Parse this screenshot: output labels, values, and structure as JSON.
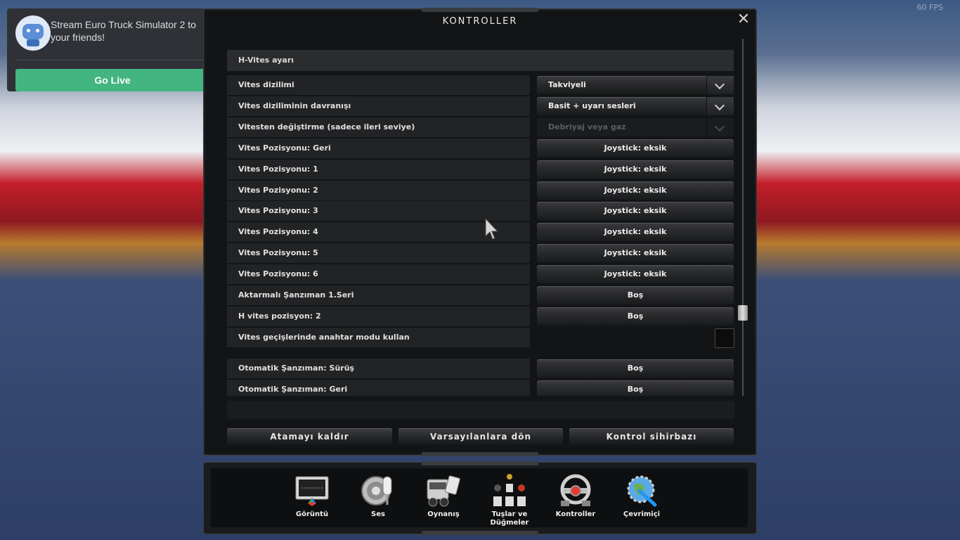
{
  "fps": "60 FPS",
  "discord": {
    "message": "Stream Euro Truck Simulator 2 to your friends!",
    "go_live": "Go Live"
  },
  "dialog": {
    "title": "KONTROLLER",
    "close": "✕",
    "section": "H-Vites ayarı",
    "rows": [
      {
        "label": "Vites dizilimi",
        "value": "Takviyeli",
        "type": "dropdown"
      },
      {
        "label": "Vites diziliminin davranışı",
        "value": "Basit + uyarı sesleri",
        "type": "dropdown"
      },
      {
        "label": "Vitesten değiştirme (sadece ileri seviye)",
        "value": "Debriyaj veya gaz",
        "type": "dropdown-disabled"
      },
      {
        "label": "Vites Pozisyonu: Geri",
        "value": "Joystick: eksik",
        "type": "binding"
      },
      {
        "label": "Vites Pozisyonu: 1",
        "value": "Joystick: eksik",
        "type": "binding"
      },
      {
        "label": "Vites Pozisyonu: 2",
        "value": "Joystick: eksik",
        "type": "binding"
      },
      {
        "label": "Vites Pozisyonu: 3",
        "value": "Joystick: eksik",
        "type": "binding"
      },
      {
        "label": "Vites Pozisyonu: 4",
        "value": "Joystick: eksik",
        "type": "binding"
      },
      {
        "label": "Vites Pozisyonu: 5",
        "value": "Joystick: eksik",
        "type": "binding"
      },
      {
        "label": "Vites Pozisyonu: 6",
        "value": "Joystick: eksik",
        "type": "binding"
      },
      {
        "label": "Aktarmalı Şanzıman 1.Seri",
        "value": "Boş",
        "type": "binding"
      },
      {
        "label": "H vites pozisyon: 2",
        "value": "Boş",
        "type": "binding"
      },
      {
        "label": "Vites geçişlerinde anahtar modu kullan",
        "value": "",
        "type": "checkbox"
      },
      {
        "label": "Otomatik Şanzıman: Sürüş",
        "value": "Boş",
        "type": "binding"
      },
      {
        "label": "Otomatik Şanzıman: Geri",
        "value": "Boş",
        "type": "binding"
      }
    ],
    "buttons": {
      "unassign": "Atamayı kaldır",
      "defaults": "Varsayılanlara dön",
      "wizard": "Kontrol sihirbazı"
    }
  },
  "nav": {
    "items": [
      {
        "label": "Görüntü",
        "icon": "display-icon"
      },
      {
        "label": "Ses",
        "icon": "speaker-microphone-icon"
      },
      {
        "label": "Oynanış",
        "icon": "truck-gameplay-icon"
      },
      {
        "label": "Tuşlar ve Düğmeler",
        "icon": "keys-buttons-icon"
      },
      {
        "label": "Kontroller",
        "icon": "steering-wheel-icon"
      },
      {
        "label": "Çevrimiçi",
        "icon": "globe-wrench-icon"
      }
    ]
  }
}
